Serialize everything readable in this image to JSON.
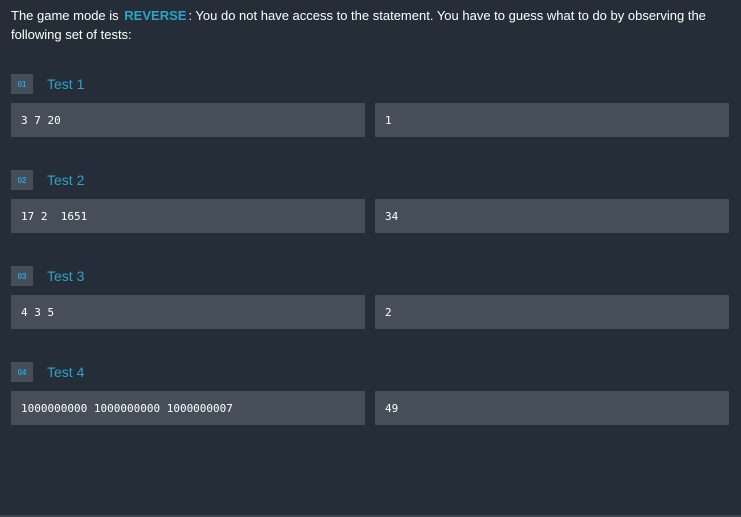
{
  "intro": {
    "prefix": "The game mode is",
    "mode": "REVERSE",
    "suffix": ": You do not have access to the statement. You have to guess what to do by observing the following set of tests:"
  },
  "tests": [
    {
      "number": "01",
      "title": "Test 1",
      "input": "3 7 20",
      "output": "1"
    },
    {
      "number": "02",
      "title": "Test 2",
      "input": "17 2  1651",
      "output": "34"
    },
    {
      "number": "03",
      "title": "Test 3",
      "input": "4 3 5",
      "output": "2"
    },
    {
      "number": "04",
      "title": "Test 4",
      "input": "1000000000 1000000000 1000000007",
      "output": "49"
    }
  ],
  "colors": {
    "background": "#252e38",
    "accent": "#2ba3cc",
    "box": "#454e59"
  }
}
